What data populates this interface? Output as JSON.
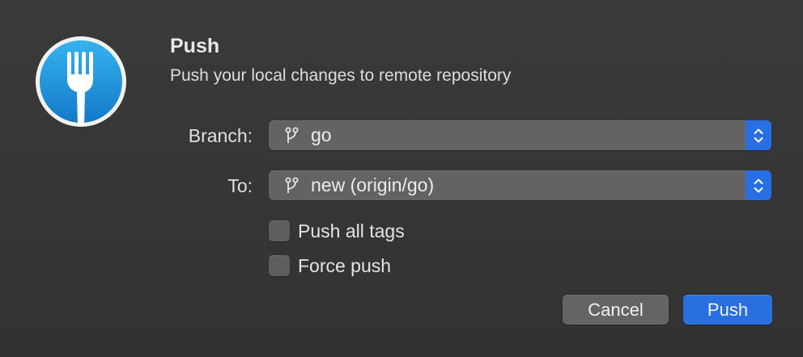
{
  "dialog": {
    "title": "Push",
    "subtitle": "Push your local changes to remote repository",
    "app_icon": "fork-app-icon"
  },
  "branch": {
    "label": "Branch:",
    "value": "go",
    "icon": "git-branch-icon"
  },
  "to": {
    "label": "To:",
    "value": "new (origin/go)",
    "icon": "git-branch-icon"
  },
  "options": {
    "push_all_tags": {
      "label": "Push all tags",
      "checked": false
    },
    "force_push": {
      "label": "Force push",
      "checked": false
    }
  },
  "buttons": {
    "cancel": "Cancel",
    "push": "Push"
  },
  "colors": {
    "accent": "#2a6fe0",
    "background": "#343434",
    "control": "#636363",
    "icon_blue": "#1a8fd8"
  }
}
